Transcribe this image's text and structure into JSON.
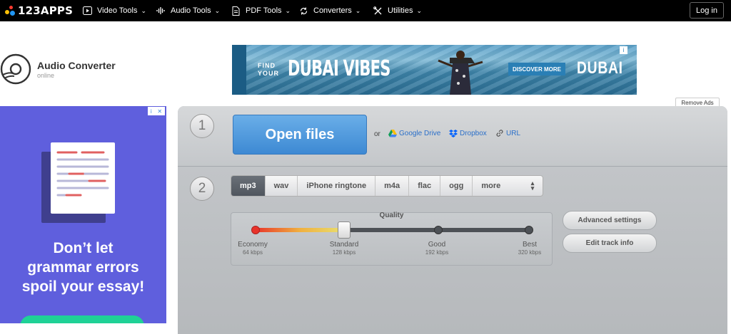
{
  "nav": {
    "logo": "123APPS",
    "items": [
      {
        "label": "Video Tools",
        "icon": "play-square-icon"
      },
      {
        "label": "Audio Tools",
        "icon": "waveform-icon"
      },
      {
        "label": "PDF Tools",
        "icon": "document-icon"
      },
      {
        "label": "Converters",
        "icon": "refresh-icon"
      },
      {
        "label": "Utilities",
        "icon": "tools-icon"
      }
    ],
    "login": "Log in"
  },
  "brand": {
    "title": "Audio Converter",
    "subtitle": "online"
  },
  "banner": {
    "find_your": [
      "FIND",
      "YOUR"
    ],
    "headline": "DUBAI VIBES",
    "cta": "DISCOVER MORE",
    "logo": "دبي"
  },
  "remove_ads": "Remove Ads",
  "left_ad": {
    "headline": [
      "Don’t let",
      "grammar errors",
      "spoil your essay!"
    ]
  },
  "step1": {
    "number": "1",
    "open_files": "Open files",
    "or": "or",
    "sources": [
      "Google Drive",
      "Dropbox",
      "URL"
    ]
  },
  "step2": {
    "number": "2",
    "formats": [
      "mp3",
      "wav",
      "iPhone ringtone",
      "m4a",
      "flac",
      "ogg",
      "more"
    ],
    "selected_format": "mp3",
    "quality": {
      "title": "Quality",
      "levels": [
        {
          "name": "Economy",
          "bitrate": "64 kbps"
        },
        {
          "name": "Standard",
          "bitrate": "128 kbps"
        },
        {
          "name": "Good",
          "bitrate": "192 kbps"
        },
        {
          "name": "Best",
          "bitrate": "320 kbps"
        }
      ],
      "selected_level": "Standard"
    },
    "advanced_settings": "Advanced settings",
    "edit_track_info": "Edit track info"
  },
  "colors": {
    "accent_blue": "#3d89d3",
    "nav_bg": "#000000",
    "ad_purple": "#5f5fdd",
    "ad_green": "#1fd196"
  }
}
